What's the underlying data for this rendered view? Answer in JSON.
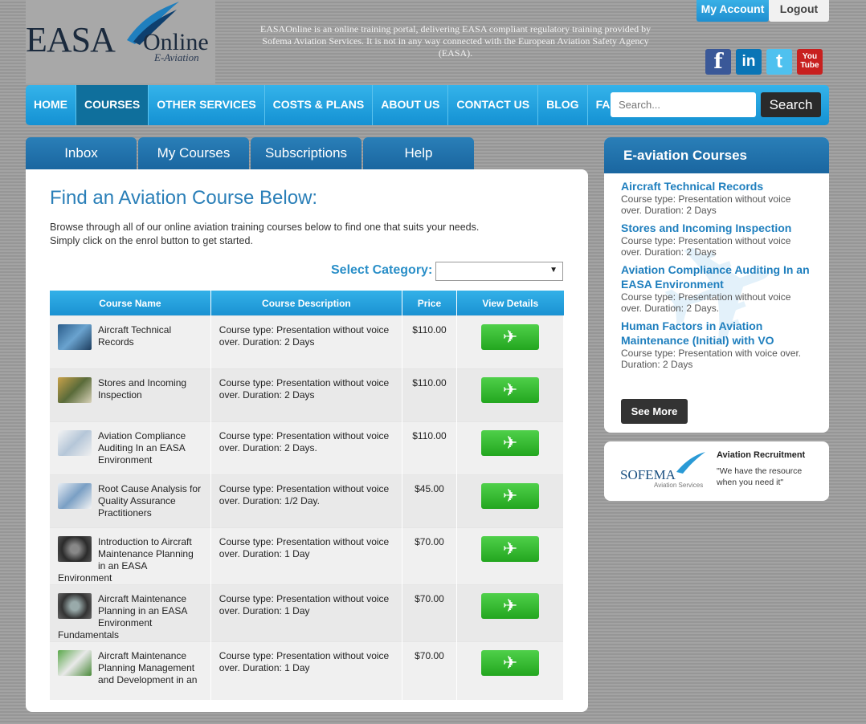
{
  "header": {
    "logo_main": "EASA",
    "logo_online": "Online",
    "logo_sub": "E-Aviation",
    "tagline": "EASAOnline is an online training portal, delivering EASA compliant regulatory training provided by Sofema Aviation Services. It is not in any way connected with the European Aviation Safety Agency (EASA).",
    "my_account": "My Account",
    "logout": "Logout",
    "social": {
      "facebook": "f",
      "linkedin": "in",
      "twitter": "t",
      "youtube_top": "You",
      "youtube_bottom": "Tube"
    }
  },
  "nav": {
    "items": [
      "HOME",
      "COURSES",
      "OTHER SERVICES",
      "COSTS & PLANS",
      "ABOUT US",
      "CONTACT US",
      "BLOG",
      "FAQ"
    ],
    "active": "COURSES",
    "search_placeholder": "Search...",
    "search_button": "Search"
  },
  "tabs": [
    "Inbox",
    "My Courses",
    "Subscriptions",
    "Help"
  ],
  "main": {
    "title": "Find an Aviation Course Below:",
    "intro_line1": "Browse through all of our online aviation training courses below to find one that suits your needs.",
    "intro_line2": "Simply click on the enrol button to get started.",
    "category_label": "Select Category:",
    "category_value": ""
  },
  "table": {
    "headers": [
      "Course Name",
      "Course Description",
      "Price",
      "View Details"
    ],
    "rows": [
      {
        "name": "Aircraft Technical Records",
        "description": "Course type: Presentation without voice over. Duration: 2 Days",
        "price": "$110.00"
      },
      {
        "name": "Stores and Incoming Inspection",
        "description": "Course type: Presentation without voice over. Duration: 2 Days",
        "price": "$110.00"
      },
      {
        "name": "Aviation Compliance Auditing In an EASA Environment",
        "description": "Course type: Presentation without voice over. Duration: 2 Days.",
        "price": "$110.00"
      },
      {
        "name": "Root Cause Analysis for Quality Assurance Practitioners",
        "description": "Course type: Presentation without voice over. Duration: 1/2 Day.",
        "price": "$45.00"
      },
      {
        "name": "Introduction to Aircraft Maintenance Planning in an EASA Environment",
        "description": "Course type: Presentation without voice over. Duration: 1 Day",
        "price": "$70.00"
      },
      {
        "name": "Aircraft Maintenance Planning in an EASA Environment Fundamentals",
        "description": "Course type: Presentation without voice over. Duration: 1 Day",
        "price": "$70.00"
      },
      {
        "name": "Aircraft Maintenance Planning Management and Development in an",
        "description": "Course type: Presentation without voice over. Duration: 1 Day",
        "price": "$70.00"
      }
    ],
    "view_icon": "✈"
  },
  "sidebar": {
    "title": "E-aviation Courses",
    "items": [
      {
        "title": "Aircraft Technical Records",
        "desc": "Course type: Presentation without voice over. Duration: 2 Days"
      },
      {
        "title": "Stores and Incoming Inspection",
        "desc": "Course type: Presentation without voice over. Duration: 2 Days"
      },
      {
        "title": "Aviation Compliance Auditing In an EASA Environment",
        "desc": "Course type: Presentation without voice over. Duration: 2 Days."
      },
      {
        "title": "Human Factors in Aviation Maintenance (Initial) with VO",
        "desc": "Course type: Presentation with voice over. Duration: 2 Days"
      }
    ],
    "see_more": "See More"
  },
  "recruit": {
    "logo": "SOFEMA",
    "logo_sub": "Aviation Services",
    "title": "Aviation Recruitment",
    "text": "\"We have the resource when you need it\""
  },
  "colors": {
    "accent": "#1f8fd0",
    "nav_active": "#0f6f9c",
    "enrol_green": "#2eb82a"
  }
}
